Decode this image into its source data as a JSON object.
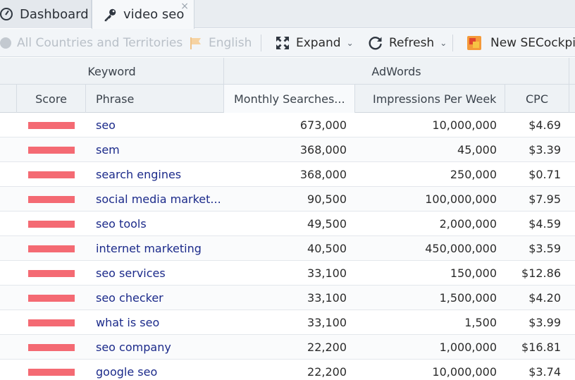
{
  "tabs": {
    "dashboard_label": "Dashboard",
    "active_label": "video seo",
    "close_glyph": "×"
  },
  "toolbar": {
    "countries_label": "All Countries and Territories",
    "language_label": "English",
    "expand_label": "Expand",
    "refresh_label": "Refresh",
    "new_label": "New SECockpit S",
    "caret": "⌄"
  },
  "grid": {
    "groups": {
      "keyword": "Keyword",
      "adwords": "AdWords"
    },
    "columns": {
      "score": "Score",
      "phrase": "Phrase",
      "monthly": "Monthly Searches...",
      "impressions": "Impressions Per Week",
      "cpc": "CPC"
    },
    "rows": [
      {
        "phrase": "seo",
        "monthly": "673,000",
        "impressions": "10,000,000",
        "cpc": "$4.69"
      },
      {
        "phrase": "sem",
        "monthly": "368,000",
        "impressions": "45,000",
        "cpc": "$3.39"
      },
      {
        "phrase": "search engines",
        "monthly": "368,000",
        "impressions": "250,000",
        "cpc": "$0.71"
      },
      {
        "phrase": "social media market...",
        "monthly": "90,500",
        "impressions": "100,000,000",
        "cpc": "$7.95"
      },
      {
        "phrase": "seo tools",
        "monthly": "49,500",
        "impressions": "2,000,000",
        "cpc": "$4.59"
      },
      {
        "phrase": "internet marketing",
        "monthly": "40,500",
        "impressions": "450,000,000",
        "cpc": "$3.59"
      },
      {
        "phrase": "seo services",
        "monthly": "33,100",
        "impressions": "150,000",
        "cpc": "$12.86"
      },
      {
        "phrase": "seo checker",
        "monthly": "33,100",
        "impressions": "1,500,000",
        "cpc": "$4.20"
      },
      {
        "phrase": "what is seo",
        "monthly": "33,100",
        "impressions": "1,500",
        "cpc": "$3.99"
      },
      {
        "phrase": "seo company",
        "monthly": "22,200",
        "impressions": "1,000,000",
        "cpc": "$16.81"
      },
      {
        "phrase": "google seo",
        "monthly": "22,200",
        "impressions": "10,000,000",
        "cpc": "$3.74"
      }
    ]
  },
  "colors": {
    "score_bar": "#f46a73",
    "phrase_link": "#1b2a8a"
  }
}
